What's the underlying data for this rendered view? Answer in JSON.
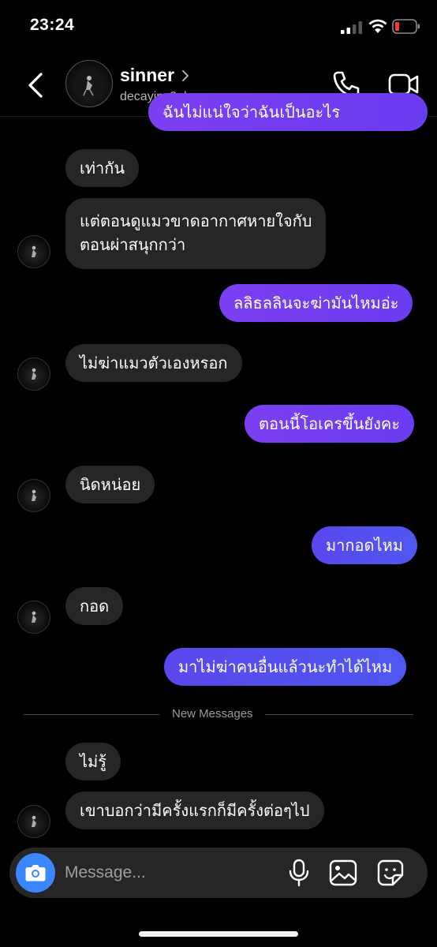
{
  "status_bar": {
    "time": "23:24",
    "battery_color": "#ff3b30"
  },
  "header": {
    "name": "sinner",
    "username": "decayins0ul",
    "icons": [
      "back-arrow-icon",
      "chevron-right-icon",
      "phone-icon",
      "video-camera-icon"
    ]
  },
  "messages": [
    {
      "side": "out",
      "text": "ฉันไม่แน่ใจว่าฉันเป็นอะไร"
    },
    {
      "side": "in",
      "text": "เท่ากัน"
    },
    {
      "side": "in",
      "line1": "แต่ตอนดูแมวขาดอากาศหายใจกับ",
      "line2": "ตอนผ่าสนุกกว่า"
    },
    {
      "side": "out",
      "text": "ลลิธลลินจะฆ่ามันไหมอ่ะ"
    },
    {
      "side": "in",
      "text": "ไม่ฆ่าแมวตัวเองหรอก"
    },
    {
      "side": "out",
      "text": "ตอนนี้โอเครขึ้นยังคะ"
    },
    {
      "side": "in",
      "text": "นิดหน่อย"
    },
    {
      "side": "out",
      "text": "มากอดไหม"
    },
    {
      "side": "in",
      "text": "กอด"
    },
    {
      "side": "out",
      "text": "มาไม่ฆ่าคนอื่นแล้วนะทำได้ไหม"
    },
    {
      "side": "in",
      "text": "ไม่รู้"
    },
    {
      "side": "in",
      "text": "เขาบอกว่ามีครั้งแรกก็มีครั้งต่อๆไป"
    }
  ],
  "divider_label": "New Messages",
  "composer": {
    "placeholder": "Message...",
    "accent": "#3a86ff",
    "icons": [
      "camera-icon",
      "microphone-icon",
      "gallery-icon",
      "sticker-icon"
    ]
  },
  "colors": {
    "outgoing_purple": "#7b3ff0",
    "outgoing_blue": "#4f57f0",
    "incoming": "#262626"
  }
}
